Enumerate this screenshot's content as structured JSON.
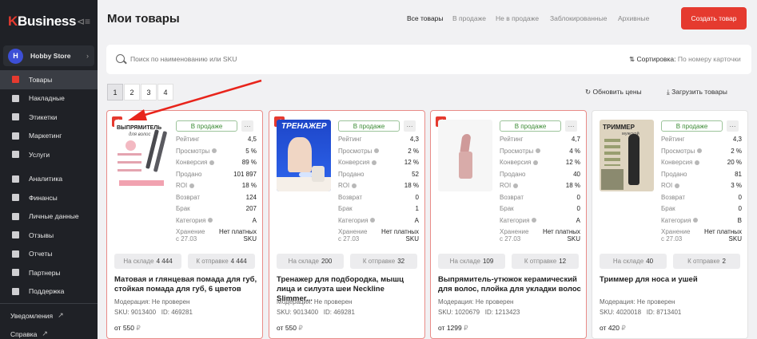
{
  "sidebar": {
    "logo_k": "K",
    "logo_text": "Business",
    "store": {
      "initial": "H",
      "name": "Hobby Store"
    },
    "items": [
      {
        "label": "Товары",
        "active": true,
        "icon": "box-icon"
      },
      {
        "label": "Накладные",
        "icon": "clipboard-icon"
      },
      {
        "label": "Этикетки",
        "icon": "tag-icon"
      },
      {
        "label": "Маркетинг",
        "icon": "percent-icon"
      },
      {
        "label": "Услуги",
        "icon": "cart-icon"
      },
      {
        "label": "Аналитика",
        "icon": "chart-icon"
      },
      {
        "label": "Финансы",
        "icon": "wallet-icon"
      },
      {
        "label": "Личные данные",
        "icon": "person-icon"
      },
      {
        "label": "Отзывы",
        "icon": "message-icon"
      },
      {
        "label": "Отчеты",
        "icon": "document-icon"
      },
      {
        "label": "Партнеры",
        "icon": "partners-icon"
      },
      {
        "label": "Поддержка",
        "icon": "headset-icon"
      }
    ],
    "notifications": "Уведомления",
    "help": "Справка"
  },
  "header": {
    "title": "Мои товары",
    "filters": [
      "Все товары",
      "В продаже",
      "Не в продаже",
      "Заблокированные",
      "Архивные"
    ],
    "create_button": "Создать товар"
  },
  "search": {
    "placeholder": "Поиск по наименованию или SKU",
    "sort_label": "Сортировка:",
    "sort_value": "По номеру карточки"
  },
  "pagination": {
    "pages": [
      "1",
      "2",
      "3",
      "4"
    ],
    "current": "1"
  },
  "actions": {
    "refresh_prices": "Обновить цены",
    "upload_products": "Загрузить товары"
  },
  "labels": {
    "rating": "Рейтинг",
    "views": "Просмотры",
    "conversion": "Конверсия",
    "sold": "Продано",
    "roi": "ROI",
    "returns": "Возврат",
    "defect": "Брак",
    "category": "Категория",
    "storage": "Хранение с 27.03",
    "in_stock": "На складе",
    "to_ship": "К отправке",
    "moderation": "Модерация: Не проверен",
    "sku_prefix": "SKU:",
    "id_prefix": "ID:",
    "price_prefix": "от",
    "currency": "₽",
    "no_paid_sku": "Нет платных SKU"
  },
  "products": [
    {
      "selected": true,
      "status": "В продаже",
      "thumb_text": "ВЫПРЯМИТЕЛЬ",
      "thumb_sub": "для волос",
      "rating": "4,5",
      "views": "5 %",
      "conversion": "89 %",
      "sold": "101 897",
      "roi": "18 %",
      "returns": "124",
      "defect": "207",
      "category": "A",
      "in_stock": "4 444",
      "to_ship": "4 444",
      "title": "Матовая и глянцевая помада для губ, стойкая помада для губ, 6 цветов",
      "sku": "9013400",
      "id": "469281",
      "price": "550"
    },
    {
      "selected": true,
      "status": "В продаже",
      "thumb_text": "ТРЕНАЖЕР",
      "rating": "4,3",
      "views": "2 %",
      "conversion": "12 %",
      "sold": "52",
      "roi": "18 %",
      "returns": "0",
      "defect": "1",
      "category": "A",
      "in_stock": "200",
      "to_ship": "32",
      "title": "Тренажер для подбородка, мышц лица и силуэта шеи Neckline Slimmer...",
      "sku": "9013400",
      "id": "469281",
      "price": "550"
    },
    {
      "selected": true,
      "status": "В продаже",
      "rating": "4,7",
      "views": "4 %",
      "conversion": "12 %",
      "sold": "40",
      "roi": "18 %",
      "returns": "0",
      "defect": "0",
      "category": "A",
      "in_stock": "109",
      "to_ship": "12",
      "title": "Выпрямитель-утюжок керамический для волос, плойка для укладки волос",
      "sku": "1020679",
      "id": "1213423",
      "price": "1299"
    },
    {
      "selected": false,
      "status": "В продаже",
      "thumb_text": "ТРИММЕР",
      "thumb_sub": "мужской",
      "rating": "4,3",
      "views": "2 %",
      "conversion": "20 %",
      "sold": "81",
      "roi": "3 %",
      "returns": "0",
      "defect": "0",
      "category": "B",
      "in_stock": "40",
      "to_ship": "2",
      "title": "Триммер для носа и ушей",
      "sku": "4020018",
      "id": "8713401",
      "price": "420"
    }
  ],
  "colors": {
    "accent": "#e53a2f",
    "sidebar": "#1f2126",
    "status_green": "#3a8a33"
  }
}
